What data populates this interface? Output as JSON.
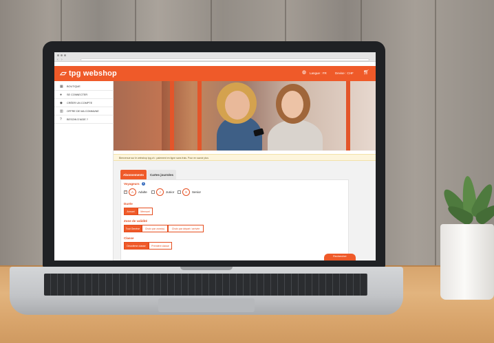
{
  "browser": {
    "nav_back": "‹",
    "nav_forward": "›"
  },
  "header": {
    "brand_mark": "▱",
    "brand_name": "tpg webshop",
    "language_label": "Langue : FR",
    "currency_label": "Devise : CHF",
    "globe_icon": "globe-icon",
    "cart_icon": "cart-icon"
  },
  "sidebar": {
    "items": [
      {
        "icon": "shop-icon",
        "glyph": "▦",
        "label": "BOUTIQUE"
      },
      {
        "icon": "user-icon",
        "glyph": "●",
        "label": "SE CONNECTER"
      },
      {
        "icon": "users-icon",
        "glyph": "◆",
        "label": "CRÉER UN COMPTE"
      },
      {
        "icon": "building-icon",
        "glyph": "▥",
        "label": "OFFRE DE MA COMMUNE"
      },
      {
        "icon": "help-icon",
        "glyph": "?",
        "label": "BESOIN D'AIDE ?"
      }
    ]
  },
  "notice": {
    "text": "Bienvenue sur le webshop tpg.ch : paiement en ligne sans frais. Pour en savoir plus"
  },
  "tabs": [
    {
      "label": "Abonnements",
      "active": true
    },
    {
      "label": "Cartes journées",
      "active": false
    }
  ],
  "form": {
    "voyageurs": {
      "label": "Voyageurs",
      "info": "i",
      "options": [
        {
          "letter": "A",
          "label": "Adulte",
          "checked": true
        },
        {
          "letter": "J",
          "label": "Junior",
          "checked": false
        },
        {
          "letter": "S",
          "label": "Senior",
          "checked": false
        }
      ]
    },
    "duree": {
      "label": "Durée",
      "options": [
        {
          "label": "Annuel",
          "selected": true
        },
        {
          "label": "Mensuel",
          "selected": false
        }
      ]
    },
    "zone": {
      "label": "Zone de validité",
      "options": [
        {
          "label": "Tout Genève",
          "selected": true
        },
        {
          "label": "Choix par zone(s)",
          "selected": false
        },
        {
          "label": "Choix par départ / arrivée",
          "selected": false
        }
      ]
    },
    "classe": {
      "label": "Classe",
      "options": [
        {
          "label": "Deuxième classe",
          "selected": true
        },
        {
          "label": "Première classe",
          "selected": false
        }
      ]
    },
    "cta_label": "Rechercher"
  },
  "colors": {
    "brand_orange": "#ef5a29",
    "accent_red": "#e54d1e",
    "notice_bg": "#fdf5dc"
  }
}
